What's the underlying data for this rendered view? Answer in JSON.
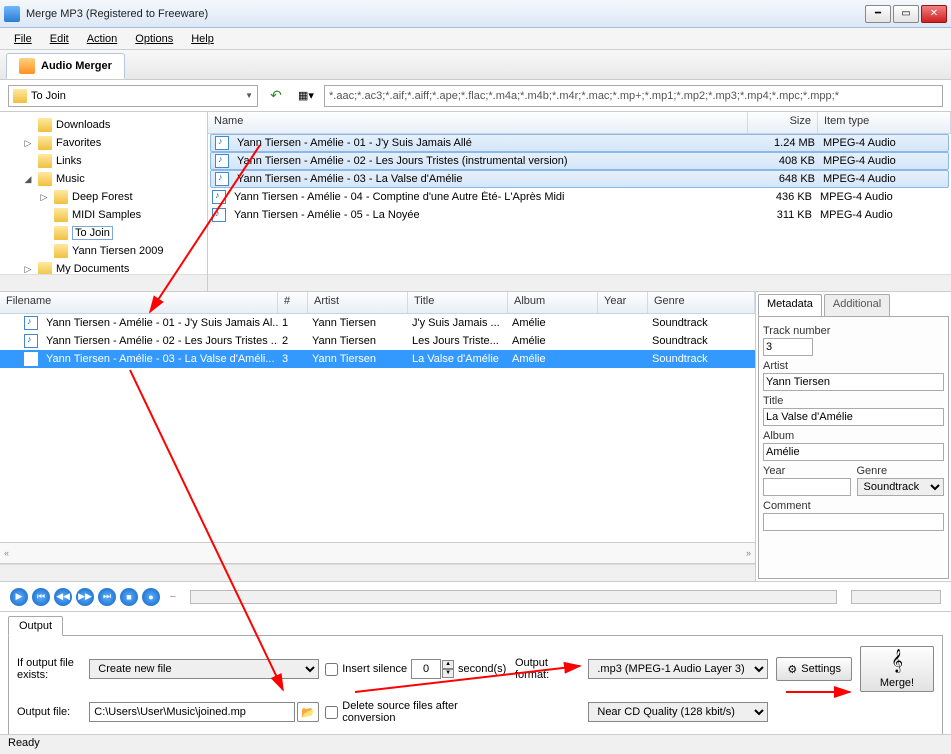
{
  "window": {
    "title": "Merge MP3 (Registered to Freeware)"
  },
  "menu": {
    "file": "File",
    "edit": "Edit",
    "action": "Action",
    "options": "Options",
    "help": "Help"
  },
  "tab": {
    "main": "Audio Merger"
  },
  "toolbar": {
    "folder_combo": "To Join",
    "filter": "*.aac;*.ac3;*.aif;*.aiff;*.ape;*.flac;*.m4a;*.m4b;*.m4r;*.mac;*.mp+;*.mp1;*.mp2;*.mp3;*.mp4;*.mpc;*.mpp;*"
  },
  "tree": [
    {
      "indent": 1,
      "expand": "",
      "label": "Downloads"
    },
    {
      "indent": 1,
      "expand": "▷",
      "label": "Favorites"
    },
    {
      "indent": 1,
      "expand": "",
      "label": "Links"
    },
    {
      "indent": 1,
      "expand": "◢",
      "label": "Music"
    },
    {
      "indent": 2,
      "expand": "▷",
      "label": "Deep Forest"
    },
    {
      "indent": 2,
      "expand": "",
      "label": "MIDI Samples"
    },
    {
      "indent": 2,
      "expand": "",
      "label": "To Join",
      "sel": true
    },
    {
      "indent": 2,
      "expand": "",
      "label": "Yann Tiersen 2009"
    },
    {
      "indent": 1,
      "expand": "▷",
      "label": "My Documents"
    }
  ],
  "filegrid": {
    "headers": {
      "name": "Name",
      "size": "Size",
      "type": "Item type"
    },
    "rows": [
      {
        "name": "Yann Tiersen - Amélie - 01 - J'y Suis Jamais Allé",
        "size": "1.24 MB",
        "type": "MPEG-4 Audio",
        "sel": true
      },
      {
        "name": "Yann Tiersen - Amélie - 02 - Les Jours Tristes (instrumental version)",
        "size": "408 KB",
        "type": "MPEG-4 Audio",
        "sel": true
      },
      {
        "name": "Yann Tiersen - Amélie - 03 - La Valse d'Amélie",
        "size": "648 KB",
        "type": "MPEG-4 Audio",
        "sel": true
      },
      {
        "name": "Yann Tiersen - Amélie - 04 - Comptine d'une Autre Été- L'Après Midi",
        "size": "436 KB",
        "type": "MPEG-4 Audio",
        "sel": false
      },
      {
        "name": "Yann Tiersen - Amélie - 05 - La Noyée",
        "size": "311 KB",
        "type": "MPEG-4 Audio",
        "sel": false
      }
    ]
  },
  "queue": {
    "headers": {
      "filename": "Filename",
      "num": "#",
      "artist": "Artist",
      "title": "Title",
      "album": "Album",
      "year": "Year",
      "genre": "Genre"
    },
    "rows": [
      {
        "filename": "Yann Tiersen - Amélie - 01 - J'y Suis Jamais Al...",
        "num": "1",
        "artist": "Yann Tiersen",
        "title": "J'y Suis Jamais ...",
        "album": "Amélie",
        "year": "",
        "genre": "Soundtrack",
        "sel": false
      },
      {
        "filename": "Yann Tiersen - Amélie - 02 - Les Jours Tristes ...",
        "num": "2",
        "artist": "Yann Tiersen",
        "title": "Les Jours Triste...",
        "album": "Amélie",
        "year": "",
        "genre": "Soundtrack",
        "sel": false
      },
      {
        "filename": "Yann Tiersen - Amélie - 03 - La Valse d'Améli...",
        "num": "3",
        "artist": "Yann Tiersen",
        "title": "La Valse d'Amélie",
        "album": "Amélie",
        "year": "",
        "genre": "Soundtrack",
        "sel": true
      }
    ]
  },
  "meta": {
    "tabs": {
      "metadata": "Metadata",
      "additional": "Additional"
    },
    "labels": {
      "tracknum": "Track number",
      "artist": "Artist",
      "title": "Title",
      "album": "Album",
      "year": "Year",
      "genre": "Genre",
      "comment": "Comment"
    },
    "values": {
      "tracknum": "3",
      "artist": "Yann Tiersen",
      "title": "La Valse d'Amélie",
      "album": "Amélie",
      "year": "",
      "genre": "Soundtrack",
      "comment": ""
    }
  },
  "output": {
    "tab": "Output",
    "if_exists_label": "If output file exists:",
    "if_exists_value": "Create new file",
    "insert_silence": "Insert silence",
    "silence_val": "0",
    "seconds": "second(s)",
    "output_file_label": "Output file:",
    "output_file_value": "C:\\Users\\User\\Music\\joined.mp",
    "delete_source": "Delete source files after conversion",
    "format_label": "Output format:",
    "format_value": ".mp3 (MPEG-1 Audio Layer 3)",
    "quality_value": "Near CD Quality (128 kbit/s)",
    "settings": "Settings",
    "merge": "Merge!"
  },
  "status": {
    "text": "Ready"
  }
}
